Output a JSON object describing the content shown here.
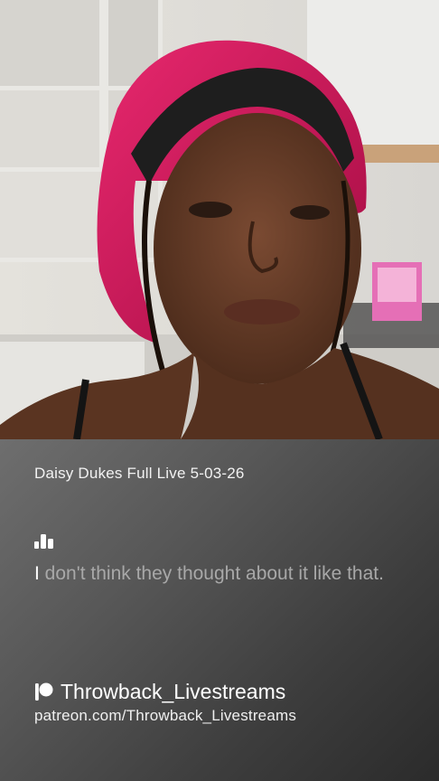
{
  "video": {
    "still_description_icon": "live-video-frame"
  },
  "card": {
    "title": "Daisy Dukes Full Live 5-03-26",
    "transcript_icon": "audio-bars-icon",
    "transcript_first_char": "I",
    "transcript_rest": " don't think they thought about it like that.",
    "channel_icon": "patreon-icon",
    "channel_name": "Throwback_Livestreams",
    "channel_url": "patreon.com/Throwback_Livestreams"
  },
  "colors": {
    "bonnet": "#d4145a",
    "headband": "#1e1e1e",
    "card_text": "#ffffff",
    "transcript_dim": "#a8a8a8"
  }
}
